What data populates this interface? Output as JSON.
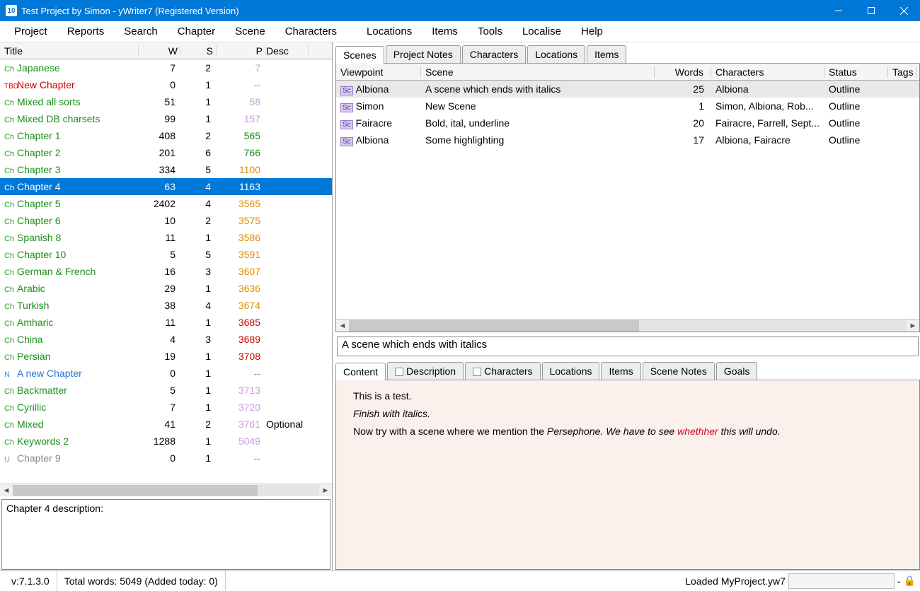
{
  "window": {
    "title": "Test Project by Simon - yWriter7 (Registered Version)"
  },
  "menu": [
    "Project",
    "Reports",
    "Search",
    "Chapter",
    "Scene",
    "Characters",
    "Locations",
    "Items",
    "Tools",
    "Localise",
    "Help"
  ],
  "chapters": {
    "headers": {
      "title": "Title",
      "w": "W",
      "s": "S",
      "p": "P",
      "desc": "Desc"
    },
    "rows": [
      {
        "pre": "Ch",
        "pc": "pre-ch",
        "title": "Japanese",
        "tc": "t-green",
        "w": "7",
        "s": "2",
        "p": "7",
        "pcol": "p-violet",
        "desc": ""
      },
      {
        "pre": "TBD",
        "pc": "pre-tb",
        "title": "New Chapter",
        "tc": "t-red",
        "w": "0",
        "s": "1",
        "p": "--",
        "pcol": "p-gray",
        "desc": ""
      },
      {
        "pre": "Ch",
        "pc": "pre-ch",
        "title": "Mixed all sorts",
        "tc": "t-green",
        "w": "51",
        "s": "1",
        "p": "58",
        "pcol": "p-violet",
        "desc": ""
      },
      {
        "pre": "Ch",
        "pc": "pre-ch",
        "title": "Mixed DB charsets",
        "tc": "t-green",
        "w": "99",
        "s": "1",
        "p": "157",
        "pcol": "p-violet",
        "desc": ""
      },
      {
        "pre": "Ch",
        "pc": "pre-ch",
        "title": "Chapter 1",
        "tc": "t-green",
        "w": "408",
        "s": "2",
        "p": "565",
        "pcol": "p-green",
        "desc": ""
      },
      {
        "pre": "Ch",
        "pc": "pre-ch",
        "title": "Chapter 2",
        "tc": "t-green",
        "w": "201",
        "s": "6",
        "p": "766",
        "pcol": "p-green",
        "desc": ""
      },
      {
        "pre": "Ch",
        "pc": "pre-ch",
        "title": "Chapter 3",
        "tc": "t-green",
        "w": "334",
        "s": "5",
        "p": "1100",
        "pcol": "p-orange",
        "desc": ""
      },
      {
        "pre": "Ch",
        "pc": "pre-ch",
        "title": "Chapter 4",
        "tc": "t-green",
        "w": "63",
        "s": "4",
        "p": "1163",
        "pcol": "p-orange",
        "desc": "",
        "sel": true
      },
      {
        "pre": "Ch",
        "pc": "pre-ch",
        "title": "Chapter 5",
        "tc": "t-green",
        "w": "2402",
        "s": "4",
        "p": "3565",
        "pcol": "p-orange",
        "desc": ""
      },
      {
        "pre": "Ch",
        "pc": "pre-ch",
        "title": "Chapter 6",
        "tc": "t-green",
        "w": "10",
        "s": "2",
        "p": "3575",
        "pcol": "p-orange",
        "desc": ""
      },
      {
        "pre": "Ch",
        "pc": "pre-ch",
        "title": "Spanish 8",
        "tc": "t-green",
        "w": "11",
        "s": "1",
        "p": "3586",
        "pcol": "p-orange",
        "desc": ""
      },
      {
        "pre": "Ch",
        "pc": "pre-ch",
        "title": "Chapter 10",
        "tc": "t-green",
        "w": "5",
        "s": "5",
        "p": "3591",
        "pcol": "p-orange",
        "desc": ""
      },
      {
        "pre": "Ch",
        "pc": "pre-ch",
        "title": "German & French",
        "tc": "t-green",
        "w": "16",
        "s": "3",
        "p": "3607",
        "pcol": "p-orange",
        "desc": ""
      },
      {
        "pre": "Ch",
        "pc": "pre-ch",
        "title": "Arabic",
        "tc": "t-green",
        "w": "29",
        "s": "1",
        "p": "3636",
        "pcol": "p-orange",
        "desc": ""
      },
      {
        "pre": "Ch",
        "pc": "pre-ch",
        "title": "Turkish",
        "tc": "t-green",
        "w": "38",
        "s": "4",
        "p": "3674",
        "pcol": "p-orange",
        "desc": ""
      },
      {
        "pre": "Ch",
        "pc": "pre-ch",
        "title": "Amharic",
        "tc": "t-green",
        "w": "11",
        "s": "1",
        "p": "3685",
        "pcol": "p-red",
        "desc": ""
      },
      {
        "pre": "Ch",
        "pc": "pre-ch",
        "title": "China",
        "tc": "t-green",
        "w": "4",
        "s": "3",
        "p": "3689",
        "pcol": "p-red",
        "desc": ""
      },
      {
        "pre": "Ch",
        "pc": "pre-ch",
        "title": "Persian",
        "tc": "t-green",
        "w": "19",
        "s": "1",
        "p": "3708",
        "pcol": "p-red",
        "desc": ""
      },
      {
        "pre": "N",
        "pc": "pre-n",
        "title": "A new Chapter",
        "tc": "t-blue",
        "w": "0",
        "s": "1",
        "p": "--",
        "pcol": "p-gray",
        "desc": ""
      },
      {
        "pre": "Ch",
        "pc": "pre-ch",
        "title": "Backmatter",
        "tc": "t-green",
        "w": "5",
        "s": "1",
        "p": "3713",
        "pcol": "p-violet",
        "desc": ""
      },
      {
        "pre": "Ch",
        "pc": "pre-ch",
        "title": "Cyrillic",
        "tc": "t-green",
        "w": "7",
        "s": "1",
        "p": "3720",
        "pcol": "p-violet",
        "desc": ""
      },
      {
        "pre": "Ch",
        "pc": "pre-ch",
        "title": "Mixed",
        "tc": "t-green",
        "w": "41",
        "s": "2",
        "p": "3761",
        "pcol": "p-violet",
        "desc": "Optional"
      },
      {
        "pre": "Ch",
        "pc": "pre-ch",
        "title": "Keywords 2",
        "tc": "t-green",
        "w": "1288",
        "s": "1",
        "p": "5049",
        "pcol": "p-violet",
        "desc": ""
      },
      {
        "pre": "U",
        "pc": "pre-u",
        "title": "Chapter 9",
        "tc": "t-gray",
        "w": "0",
        "s": "1",
        "p": "--",
        "pcol": "p-gray",
        "desc": ""
      }
    ]
  },
  "description": "Chapter 4 description:",
  "right_tabs": [
    "Scenes",
    "Project Notes",
    "Characters",
    "Locations",
    "Items"
  ],
  "scenes": {
    "headers": {
      "vp": "Viewpoint",
      "scene": "Scene",
      "words": "Words",
      "chars": "Characters",
      "status": "Status",
      "tags": "Tags"
    },
    "rows": [
      {
        "vp": "Albiona",
        "scene": "A scene which ends with italics",
        "words": "25",
        "chars": "Albiona",
        "status": "Outline",
        "sel": true
      },
      {
        "vp": "Simon",
        "scene": "New Scene",
        "words": "1",
        "chars": "Simon, Albiona, Rob...",
        "status": "Outline"
      },
      {
        "vp": "Fairacre",
        "scene": "Bold, ital, underline",
        "words": "20",
        "chars": "Fairacre, Farrell, Sept...",
        "status": "Outline"
      },
      {
        "vp": "Albiona",
        "scene": "Some highlighting",
        "words": "17",
        "chars": "Albiona, Fairacre",
        "status": "Outline"
      }
    ]
  },
  "scene_title": "A scene which ends with italics",
  "content_tabs": [
    "Content",
    "Description",
    "Characters",
    "Locations",
    "Items",
    "Scene Notes",
    "Goals"
  ],
  "content": {
    "line1": "This is a test.",
    "line2": "Finish with italics.",
    "line3a": "Now try with a scene where we mention the ",
    "line3b": "Persephone. We have to see ",
    "line3err": "whethher",
    "line3c": " this will undo."
  },
  "status": {
    "version": "v:7.1.3.0",
    "words": "Total words: 5049 (Added today: 0)",
    "loaded": "Loaded MyProject.yw7",
    "dash": "-"
  }
}
